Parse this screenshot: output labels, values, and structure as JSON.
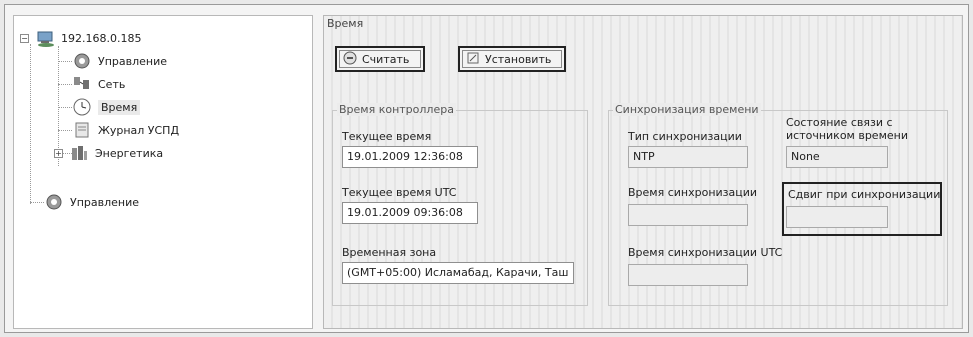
{
  "tree": {
    "root": {
      "label": "192.168.0.185",
      "expander": "−"
    },
    "children": [
      {
        "label": "Управление",
        "icon": "gear-icon"
      },
      {
        "label": "Сеть",
        "icon": "network-icon"
      },
      {
        "label": "Время",
        "icon": "clock-icon"
      },
      {
        "label": "Журнал УСПД",
        "icon": "journal-icon"
      },
      {
        "label": "Энергетика",
        "icon": "energy-icon",
        "expander": "+"
      }
    ],
    "top_item": {
      "label": "Управление",
      "icon": "gear-icon"
    }
  },
  "panel": {
    "title": "Время",
    "read_button": "Считать",
    "set_button": "Установить",
    "controller_time": {
      "title": "Время контроллера",
      "current_time_label": "Текущее время",
      "current_time_value": "19.01.2009 12:36:08",
      "current_utc_label": "Текущее время UTC",
      "current_utc_value": "19.01.2009 09:36:08",
      "timezone_label": "Временная зона",
      "timezone_value": "(GMT+05:00) Исламабад, Карачи, Таш"
    },
    "sync": {
      "title": "Синхронизация времени",
      "sync_type_label": "Тип синхронизации",
      "sync_type_value": "NTP",
      "source_status_label_1": "Состояние связи с",
      "source_status_label_2": "источником времени",
      "source_status_value": "None",
      "sync_time_label": "Время синхронизации",
      "sync_time_value": "",
      "sync_offset_label": "Сдвиг при синхронизации",
      "sync_offset_value": "",
      "sync_time_utc_label": "Время синхронизации UTC",
      "sync_time_utc_value": ""
    }
  }
}
